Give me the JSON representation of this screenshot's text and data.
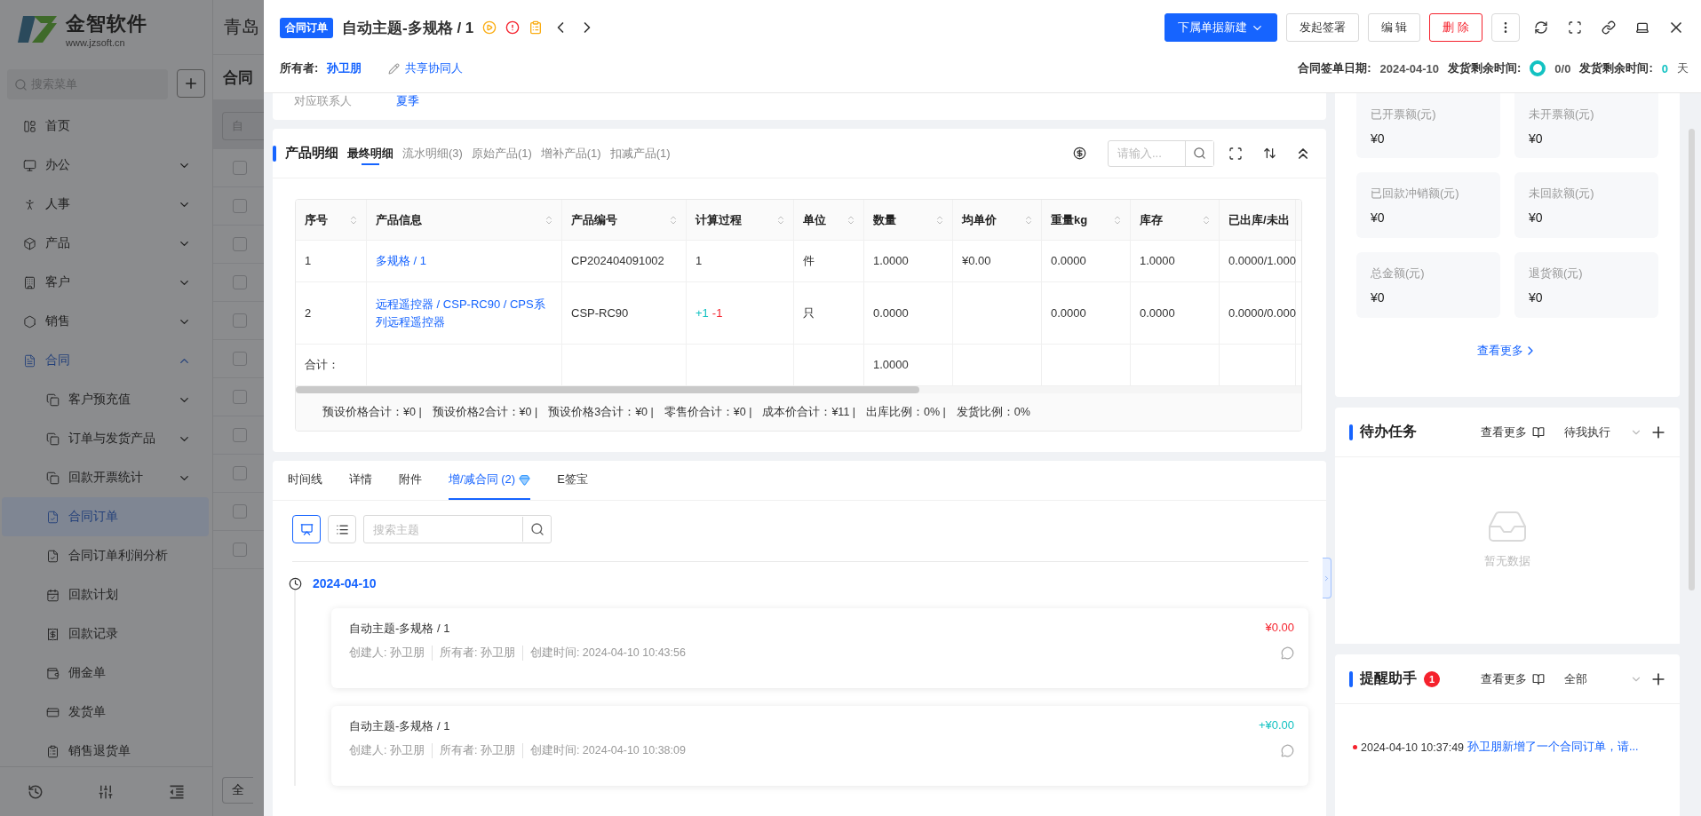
{
  "sidebar": {
    "logo": {
      "name": "金智软件",
      "url": "www.jzsoft.cn"
    },
    "search": {
      "placeholder": "搜索菜单"
    },
    "items": [
      {
        "label": "首页",
        "kind": "page",
        "selected": false
      },
      {
        "label": "办公",
        "kind": "group",
        "expanded": false,
        "selected": false
      },
      {
        "label": "人事",
        "kind": "group",
        "expanded": false,
        "selected": false
      },
      {
        "label": "产品",
        "kind": "group",
        "expanded": false,
        "selected": false
      },
      {
        "label": "客户",
        "kind": "group",
        "expanded": false,
        "selected": false
      },
      {
        "label": "销售",
        "kind": "group",
        "expanded": false,
        "selected": false
      },
      {
        "label": "合同",
        "kind": "group",
        "expanded": true,
        "selected": false,
        "children": [
          {
            "label": "客户预充值",
            "kind": "group",
            "expanded": false,
            "selected": false
          },
          {
            "label": "订单与发货产品",
            "kind": "group",
            "expanded": false,
            "selected": false
          },
          {
            "label": "回款开票统计",
            "kind": "group",
            "expanded": false,
            "selected": false
          },
          {
            "label": "合同订单",
            "kind": "page",
            "selected": true
          },
          {
            "label": "合同订单利润分析",
            "kind": "page",
            "selected": false
          },
          {
            "label": "回款计划",
            "kind": "page",
            "selected": false
          },
          {
            "label": "回款记录",
            "kind": "page",
            "selected": false
          },
          {
            "label": "佣金单",
            "kind": "page",
            "selected": false
          },
          {
            "label": "发货单",
            "kind": "page",
            "selected": false
          },
          {
            "label": "销售退货单",
            "kind": "page",
            "selected": false
          }
        ]
      }
    ]
  },
  "background_page": {
    "company": "青岛",
    "title": "合同",
    "filter_placeholder": "自",
    "row_checkboxes": [
      {
        "checked": false
      },
      {
        "checked": false
      },
      {
        "checked": false
      },
      {
        "checked": false
      },
      {
        "checked": false
      },
      {
        "checked": false
      },
      {
        "checked": false
      },
      {
        "checked": false
      },
      {
        "checked": false
      },
      {
        "checked": false
      },
      {
        "checked": false
      }
    ],
    "footer_button": "全"
  },
  "drawer": {
    "header": {
      "badge": "合同订单",
      "title": "自动主题-多规格 / 1",
      "actions": [
        {
          "label": "下属单据新建",
          "kind": "primary"
        },
        {
          "label": "发起签署",
          "kind": "default"
        },
        {
          "label": "编 辑",
          "kind": "default"
        },
        {
          "label": "删 除",
          "kind": "danger"
        }
      ],
      "owner_label": "所有者:",
      "owner": "孙卫朋",
      "share": "共享协同人",
      "meta": [
        {
          "kind": "date",
          "label": "合同签单日期:",
          "value": "2024-04-10"
        },
        {
          "kind": "ring",
          "label": "发货剩余时间:",
          "value": "0/0"
        },
        {
          "kind": "days",
          "label": "发货剩余时间:",
          "value": "0",
          "unit": "天"
        }
      ]
    },
    "contact": {
      "label": "对应联系人",
      "value": "夏季"
    },
    "products": {
      "title": "产品明细",
      "tabs": [
        {
          "label": "最终明细",
          "selected": true
        },
        {
          "label": "流水明细(3)",
          "selected": false
        },
        {
          "label": "原始产品(1)",
          "selected": false
        },
        {
          "label": "增补产品(1)",
          "selected": false
        },
        {
          "label": "扣减产品(1)",
          "selected": false
        }
      ],
      "search": {
        "placeholder": "请输入..."
      },
      "columns": [
        "序号",
        "产品信息",
        "产品编号",
        "计算过程",
        "单位",
        "数量",
        "均单价",
        "重量kg",
        "库存",
        "已出库/未出"
      ],
      "rows": [
        {
          "index": "1",
          "product": "多规格 / 1",
          "code": "CP202404091002",
          "calc": [
            {
              "text": "1",
              "color": "#333333"
            }
          ],
          "unit": "件",
          "quantity": "1.0000",
          "unit_price": "¥0.00",
          "weight": "0.0000",
          "stock": "1.0000",
          "shipped": "0.0000/1.000"
        },
        {
          "index": "2",
          "product": "远程遥控器 / CSP-RC90 / CPS系列远程遥控器",
          "code": "CSP-RC90",
          "calc": [
            {
              "text": "+1",
              "color": "#13c2c2"
            },
            {
              "text": "-1",
              "color": "#f5222d"
            }
          ],
          "unit": "只",
          "quantity": "0.0000",
          "weight": "0.0000",
          "stock": "0.0000",
          "shipped": "0.0000/0.000"
        }
      ],
      "total": {
        "label": "合计：",
        "quantity": "1.0000"
      },
      "summary": [
        "预设价格合计：¥0 |",
        "预设价格2合计：¥0 |",
        "预设价格3合计：¥0 |",
        "零售价合计：¥0 |",
        "成本价合计：¥11 |",
        "出库比例：0% |",
        "发货比例：0%"
      ]
    },
    "records": {
      "tabs": [
        {
          "label": "时间线",
          "selected": false,
          "premium": false
        },
        {
          "label": "详情",
          "selected": false,
          "premium": false
        },
        {
          "label": "附件",
          "selected": false,
          "premium": false
        },
        {
          "label": "增/减合同 (2)",
          "selected": true,
          "premium": true
        },
        {
          "label": "E签宝",
          "selected": false,
          "premium": false
        }
      ],
      "views": [
        {
          "kind": "board",
          "selected": true
        },
        {
          "kind": "list",
          "selected": false
        }
      ],
      "search": {
        "placeholder": "搜索主题"
      },
      "timeline": [
        {
          "date": "2024-04-10",
          "entries": [
            {
              "title": "自动主题-多规格 / 1",
              "meta": [
                "创建人: 孙卫朋",
                "所有者: 孙卫朋",
                "创建时间: 2024-04-10 10:43:56"
              ],
              "amount": "¥0.00",
              "color": "#f5222d"
            },
            {
              "title": "自动主题-多规格 / 1",
              "meta": [
                "创建人: 孙卫朋",
                "所有者: 孙卫朋",
                "创建时间: 2024-04-10 10:38:09"
              ],
              "amount": "+¥0.00",
              "color": "#13c2c2"
            }
          ]
        }
      ]
    },
    "stats": {
      "items": [
        {
          "label": "已开票额(元)",
          "value": "¥0"
        },
        {
          "label": "未开票额(元)",
          "value": "¥0"
        },
        {
          "label": "已回款冲销额(元)",
          "value": "¥0"
        },
        {
          "label": "未回款额(元)",
          "value": "¥0"
        },
        {
          "label": "总金额(元)",
          "value": "¥0"
        },
        {
          "label": "退货额(元)",
          "value": "¥0"
        }
      ],
      "more": "查看更多"
    },
    "todo": {
      "title": "待办任务",
      "more": "查看更多",
      "filter": "待我执行",
      "empty": "暂无数据"
    },
    "reminders": {
      "title": "提醒助手",
      "badge": "1",
      "more": "查看更多",
      "filter": "全部",
      "items": [
        {
          "time": "2024-04-10 10:37:49",
          "text": "孙卫朋新增了一个合同订单，请..."
        }
      ]
    }
  }
}
